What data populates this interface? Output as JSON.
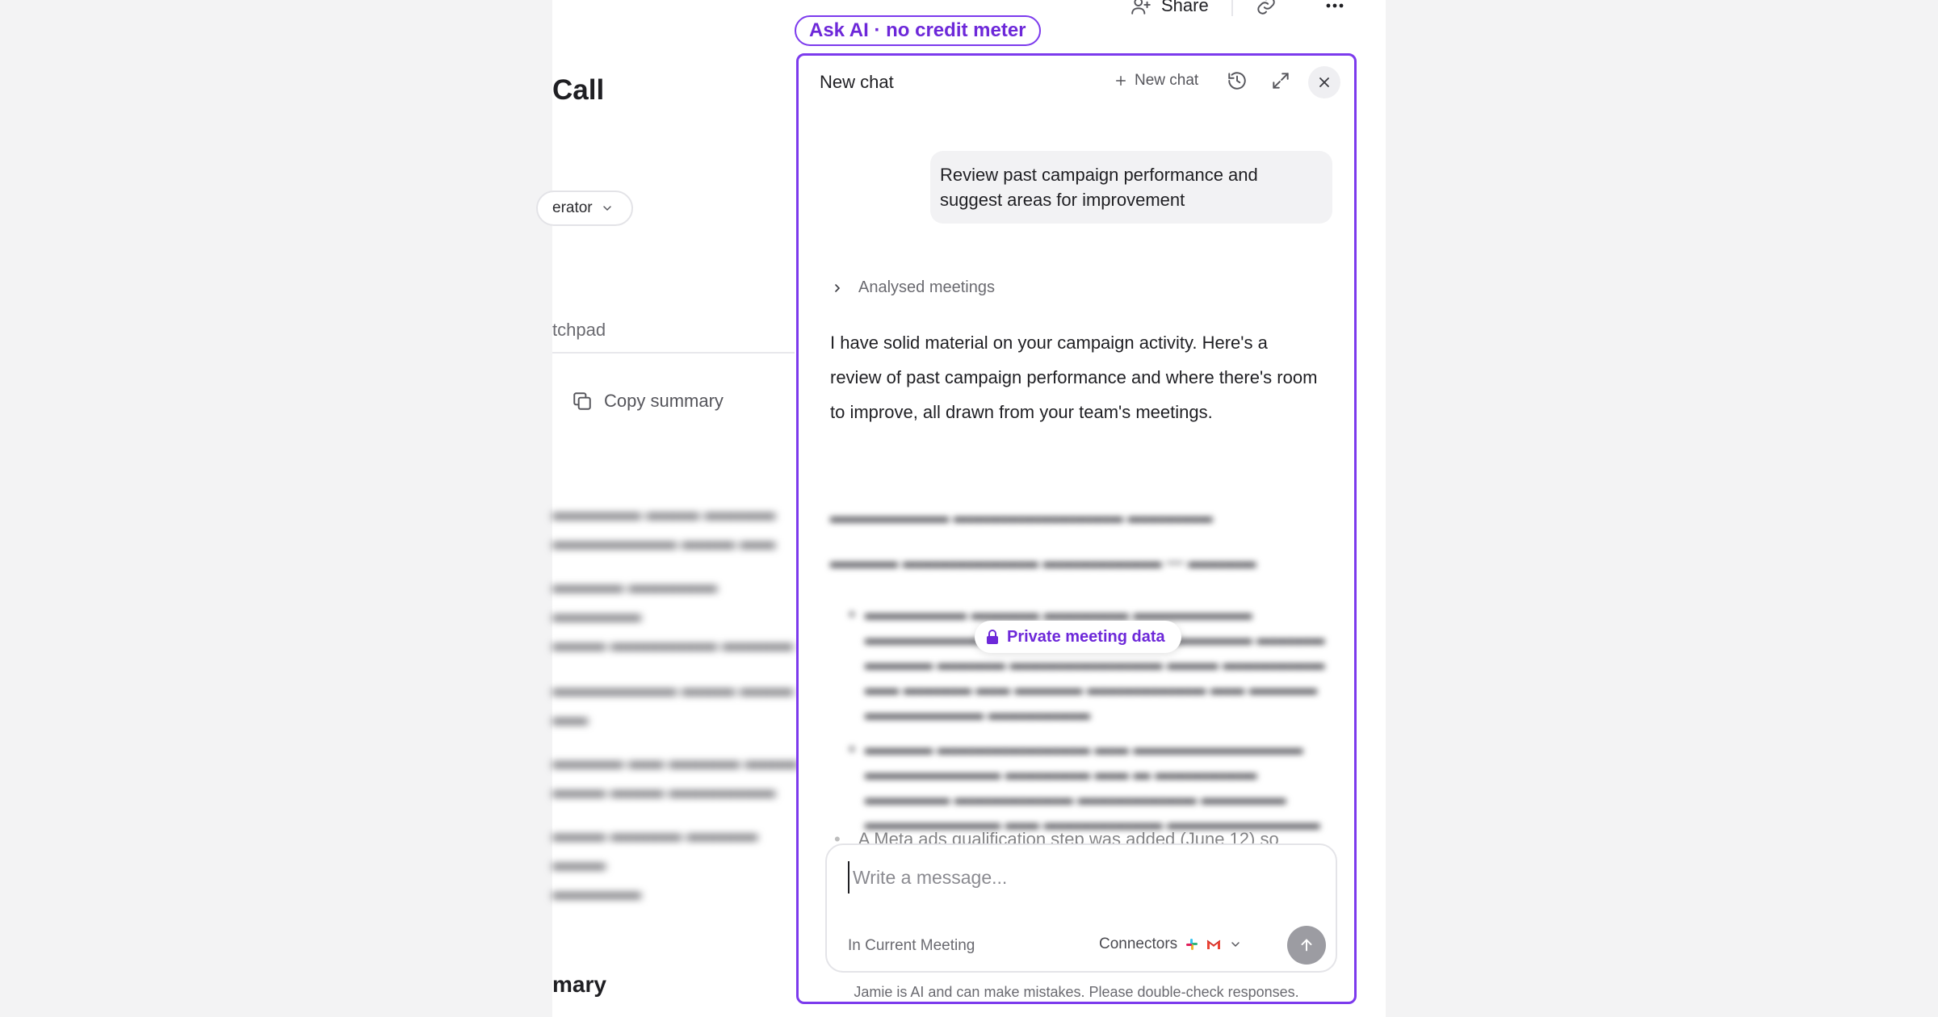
{
  "top_bar": {
    "share_label": "Share"
  },
  "background": {
    "title": "Call",
    "pill_label": "erator",
    "tab_label": "tchpad",
    "copy_summary_label": "Copy summary",
    "summary_heading": "mary"
  },
  "badge": {
    "label": "Ask AI · no credit meter"
  },
  "panel": {
    "title": "New chat",
    "new_chat_label": "New chat",
    "user_message": "Review past campaign performance and suggest areas for improvement",
    "analysed_label": "Analysed meetings",
    "ai_response": "I have solid material on your campaign activity. Here's a review of past campaign performance and where there's room to improve, all drawn from your team's meetings.",
    "private_label": "Private meeting data",
    "partial_bullet": "A Meta ads qualification step was added (June 12) so",
    "composer": {
      "placeholder": "Write a message...",
      "scope_label": "In Current Meeting",
      "connectors_label": "Connectors"
    },
    "disclaimer": "Jamie is AI and can make mistakes. Please double-check responses."
  },
  "colors": {
    "accent": "#7c3aed",
    "accent_text": "#6d28d9"
  }
}
